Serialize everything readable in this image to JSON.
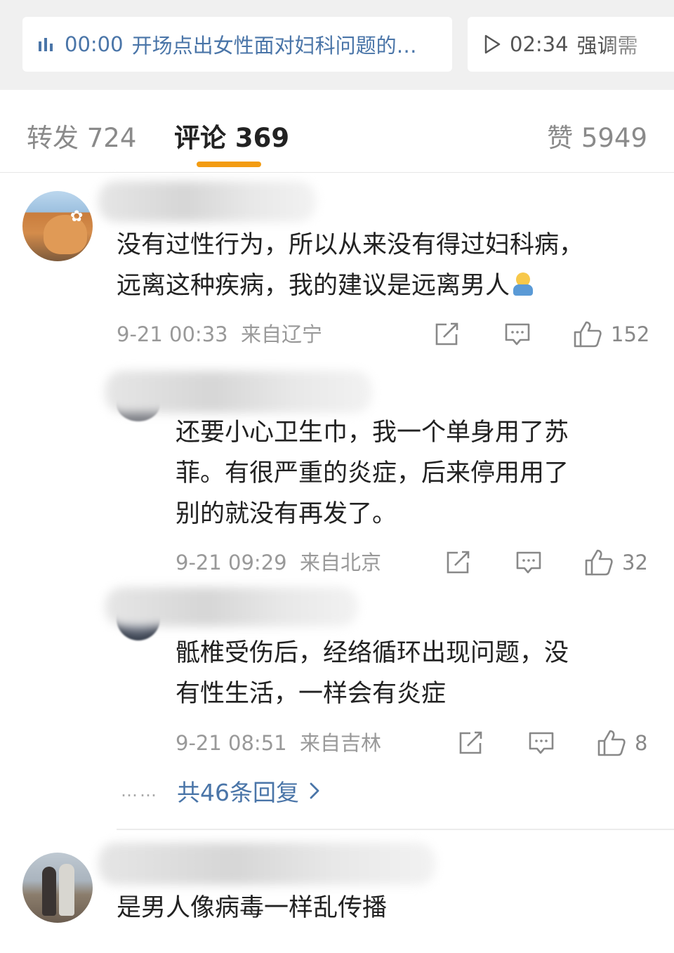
{
  "chapters": [
    {
      "time": "00:00",
      "title": "开场点出女性面对妇科问题的…",
      "icon": "audio-bars-icon"
    },
    {
      "time": "02:34",
      "title": "强调需",
      "icon": "play-icon"
    }
  ],
  "tabs": {
    "repost": "转发 724",
    "comments": "评论 369",
    "likes": "赞 5949"
  },
  "comments": [
    {
      "text_line1": "没有过性行为，所以从来没有得过妇科病，",
      "text_line2": "远离这种疾病，我的建议是远离男人",
      "emoji": "hug-emoji",
      "time": "9-21 00:33",
      "location": "来自辽宁",
      "likes": "152"
    },
    {
      "text_line1": "还要小心卫生巾，我一个单身用了苏",
      "text_line2": "菲。有很严重的炎症，后来停用用了",
      "text_line3": "别的就没有再发了。",
      "time": "9-21 09:29",
      "location": "来自北京",
      "likes": "32"
    },
    {
      "text_line1": "骶椎受伤后，经络循环出现问题，没",
      "text_line2": "有性生活，一样会有炎症",
      "time": "9-21 08:51",
      "location": "来自吉林",
      "likes": "8"
    },
    {
      "text_line1": "是男人像病毒一样乱传播"
    }
  ],
  "replies": {
    "dots": "……",
    "label": "共46条回复"
  },
  "colors": {
    "accent_blue": "#4a75a8",
    "tab_indicator": "#f39c12",
    "muted": "#999999"
  }
}
